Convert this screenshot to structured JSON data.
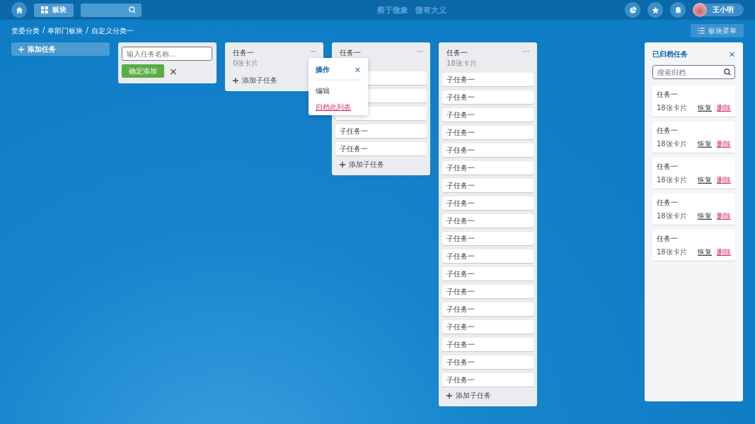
{
  "topbar": {
    "board_button": "板块",
    "slogan": [
      "察于微象",
      "微有大义"
    ],
    "user_name": "王小明"
  },
  "breadcrumb": [
    {
      "label": "党委分类"
    },
    {
      "separator": "/",
      "label": "单部门板块"
    },
    {
      "separator": "/",
      "label": "自定义分类一"
    }
  ],
  "board_menu_button": "板块菜单",
  "add_task_button": "添加任务",
  "new_list_form": {
    "placeholder": "输入任务名称...",
    "confirm": "确定添加",
    "cancel": "×"
  },
  "lists": [
    {
      "title": "任务一",
      "menu": "···",
      "subtitle": "0张卡片",
      "add": "添加子任务"
    },
    {
      "title": "任务一",
      "menu": "···",
      "cards": [
        {
          "kind": "blank"
        },
        {
          "kind": "blank"
        },
        {
          "kind": "blank"
        },
        {
          "label": "子任务一"
        },
        {
          "label": "子任务一"
        }
      ],
      "add": "添加子任务"
    },
    {
      "title": "任务一",
      "menu": "···",
      "subtitle": "18张卡片",
      "cards": [
        {
          "label": "子任务一"
        },
        {
          "label": "子任务一"
        },
        {
          "label": "子任务一"
        },
        {
          "label": "子任务一"
        },
        {
          "label": "子任务一"
        },
        {
          "label": "子任务一"
        },
        {
          "label": "子任务一"
        },
        {
          "label": "子任务一"
        },
        {
          "label": "子任务一"
        },
        {
          "label": "子任务一"
        },
        {
          "label": "子任务一"
        },
        {
          "label": "子任务一"
        },
        {
          "label": "子任务一"
        },
        {
          "label": "子任务一"
        },
        {
          "label": "子任务一"
        },
        {
          "label": "子任务一"
        },
        {
          "label": "子任务一"
        },
        {
          "label": "子任务一"
        }
      ],
      "add": "添加子任务"
    }
  ],
  "popover": {
    "title": "操作",
    "close": "✕",
    "items": [
      {
        "label": "编辑",
        "kind": "normal"
      },
      {
        "label": "归档此列表",
        "kind": "danger"
      }
    ]
  },
  "archive": {
    "title": "已归档任务",
    "close": "✕",
    "search_placeholder": "搜索归档",
    "items": [
      {
        "title": "任务一",
        "count": "18张卡片",
        "restore": "恢复",
        "delete": "删除"
      },
      {
        "title": "任务一",
        "count": "18张卡片",
        "restore": "恢复",
        "delete": "删除"
      },
      {
        "title": "任务一",
        "count": "18张卡片",
        "restore": "恢复",
        "delete": "删除"
      },
      {
        "title": "任务一",
        "count": "18张卡片",
        "restore": "恢复",
        "delete": "删除"
      },
      {
        "title": "任务一",
        "count": "18张卡片",
        "restore": "恢复",
        "delete": "删除"
      }
    ]
  }
}
